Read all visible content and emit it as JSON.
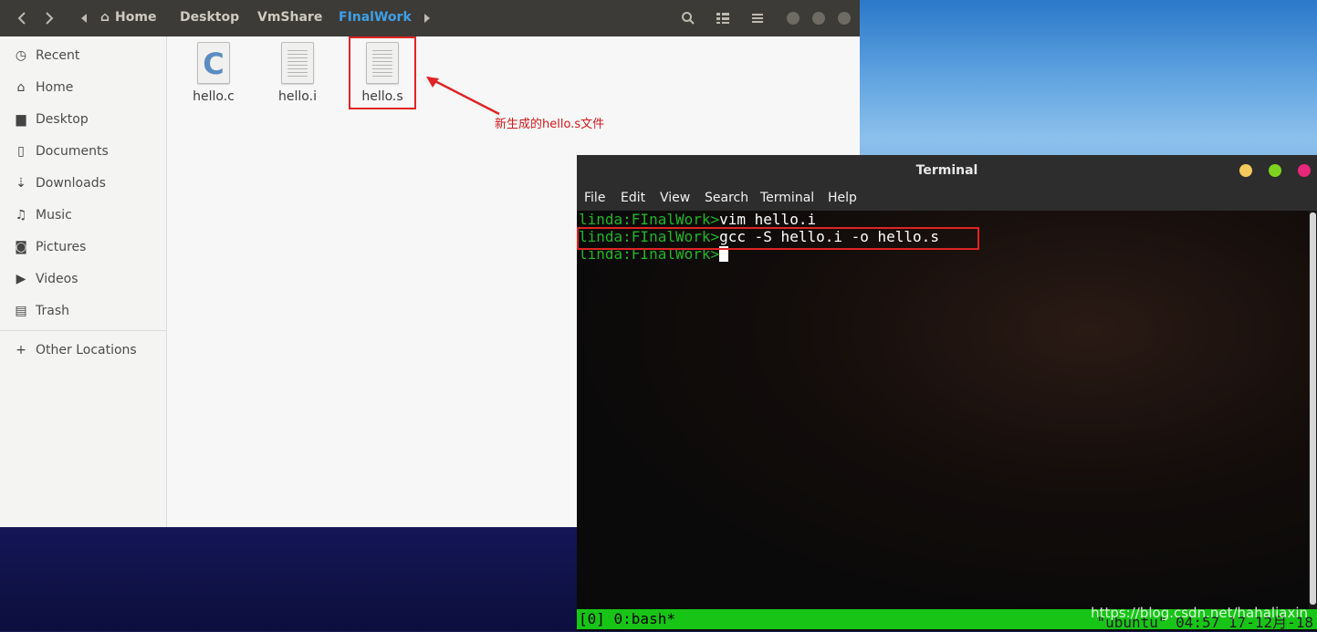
{
  "files_window": {
    "breadcrumbs": [
      "Home",
      "Desktop",
      "VmShare",
      "FInalWork"
    ],
    "active_breadcrumb": "FInalWork",
    "sidebar": [
      {
        "label": "Recent",
        "icon": "clock-icon"
      },
      {
        "label": "Home",
        "icon": "home-icon"
      },
      {
        "label": "Desktop",
        "icon": "folder-icon"
      },
      {
        "label": "Documents",
        "icon": "document-icon"
      },
      {
        "label": "Downloads",
        "icon": "download-icon"
      },
      {
        "label": "Music",
        "icon": "music-icon"
      },
      {
        "label": "Pictures",
        "icon": "camera-icon"
      },
      {
        "label": "Videos",
        "icon": "video-icon"
      },
      {
        "label": "Trash",
        "icon": "trash-icon"
      }
    ],
    "other_locations": "Other Locations",
    "files": [
      {
        "name": "hello.c",
        "type": "c-source"
      },
      {
        "name": "hello.i",
        "type": "text"
      },
      {
        "name": "hello.s",
        "type": "text"
      }
    ],
    "annotation": "新生成的hello.s文件"
  },
  "terminal": {
    "title": "Terminal",
    "menu": [
      "File",
      "Edit",
      "View",
      "Search",
      "Terminal",
      "Help"
    ],
    "lines": [
      {
        "prompt": "linda:FInalWork>",
        "command": "vim hello.i"
      },
      {
        "prompt": "linda:FInalWork>",
        "command": "gcc -S hello.i -o hello.s"
      },
      {
        "prompt": "linda:FInalWork>",
        "command": ""
      }
    ],
    "status_left": "[0] 0:bash*",
    "status_right": "\"ubuntu\" 04:57 17-12月-18"
  },
  "watermark": "https://blog.csdn.net/hahaliaxin",
  "colors": {
    "prompt": "#22b527",
    "highlight": "#e02424",
    "breadcrumb_active": "#3f9fe6",
    "status_bar": "#18c517"
  }
}
